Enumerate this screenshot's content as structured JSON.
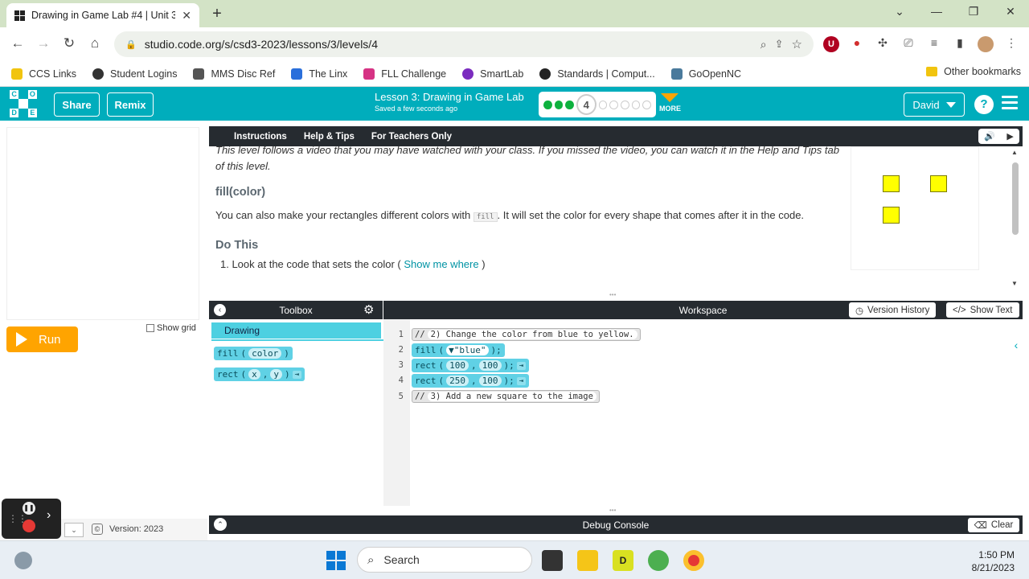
{
  "browser": {
    "tab_title": "Drawing in Game Lab #4 | Unit 3",
    "tab_close": "✕",
    "new_tab": "+",
    "url": "studio.code.org/s/csd3-2023/lessons/3/levels/4",
    "bookmarks": [
      {
        "label": "CCS Links",
        "color": "#f1c40f"
      },
      {
        "label": "Student Logins",
        "color": "#333333"
      },
      {
        "label": "MMS Disc Ref",
        "color": "#555555"
      },
      {
        "label": "The Linx",
        "color": "#2a6fdb"
      },
      {
        "label": "FLL Challenge",
        "color": "#d63384"
      },
      {
        "label": "SmartLab",
        "color": "#7b2cbf"
      },
      {
        "label": "Standards | Comput...",
        "color": "#222222"
      },
      {
        "label": "GoOpenNC",
        "color": "#4a7a9c"
      }
    ],
    "other_bookmarks": "Other bookmarks"
  },
  "header": {
    "logo_letters": [
      "C",
      "O",
      "",
      "D",
      "E",
      "",
      "",
      "",
      ""
    ],
    "share": "Share",
    "remix": "Remix",
    "lesson_title": "Lesson 3: Drawing in Game Lab",
    "saved": "Saved a few seconds ago",
    "current_level": "4",
    "more": "MORE",
    "user": "David",
    "help": "?",
    "accent": "#00adbc"
  },
  "stage": {
    "run": "Run",
    "show_grid": "Show grid",
    "version": "Version: 2023"
  },
  "instructions": {
    "tabs": [
      "Instructions",
      "Help & Tips",
      "For Teachers Only"
    ],
    "intro": "This level follows a video that you may have watched with your class. If you missed the video, you can watch it in the Help and Tips tab of this level.",
    "heading1": "fill(color)",
    "para_before": "You can also make your rectangles different colors with ",
    "para_code": "fill",
    "para_after": ". It will set the color for every shape that comes after it in the code.",
    "heading2": "Do This",
    "cut_line_start": "1. Look at the code that sets the color (",
    "cut_line_link": "Show me where",
    "cut_line_end": ")"
  },
  "toolbox": {
    "title": "Toolbox",
    "category": "Drawing",
    "blocks": [
      {
        "name": "fill",
        "args": [
          "color"
        ]
      },
      {
        "name": "rect",
        "args": [
          "x",
          "y"
        ]
      }
    ]
  },
  "workspace": {
    "title": "Workspace",
    "version_history": "Version History",
    "show_text": "Show Text",
    "lines": [
      {
        "n": "1",
        "type": "comment",
        "text": "2) Change the color from blue to yellow."
      },
      {
        "n": "2",
        "type": "fill",
        "text": "fill",
        "arg": "\"blue\""
      },
      {
        "n": "3",
        "type": "rect",
        "text": "rect",
        "a": "100",
        "b": "100"
      },
      {
        "n": "4",
        "type": "rect",
        "text": "rect",
        "a": "250",
        "b": "100"
      },
      {
        "n": "5",
        "type": "comment",
        "text": "3) Add a new square to the image"
      }
    ]
  },
  "debug": {
    "title": "Debug Console",
    "clear": "Clear"
  },
  "taskbar": {
    "search": "Search",
    "time": "1:50 PM",
    "date": "8/21/2023"
  }
}
